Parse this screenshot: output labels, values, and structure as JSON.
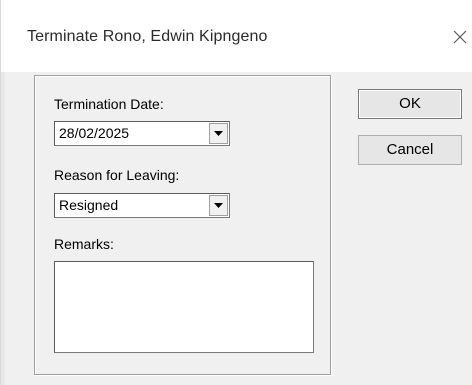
{
  "window": {
    "title": "Terminate Rono, Edwin Kipngeno",
    "close_icon": "close-icon"
  },
  "form": {
    "termination_date_label": "Termination Date:",
    "termination_date_value": "28/02/2025",
    "reason_label": "Reason for Leaving:",
    "reason_value": "Resigned",
    "remarks_label": "Remarks:",
    "remarks_value": ""
  },
  "buttons": {
    "ok_label": "OK",
    "cancel_label": "Cancel"
  },
  "colors": {
    "dialog_background": "#f0f0f0",
    "titlebar_background": "#ffffff",
    "button_background": "#e6e6e6"
  }
}
